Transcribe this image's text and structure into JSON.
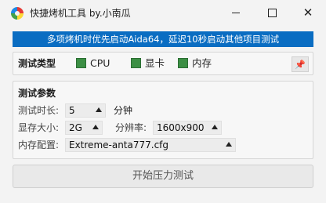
{
  "window": {
    "title": "快捷烤机工具 by.小南瓜",
    "min_icon": "minimize-icon",
    "max_icon": "maximize-icon",
    "close_icon": "close-icon"
  },
  "banner": {
    "text": "多项烤机时优先启动Aida64，延迟10秒启动其他项目测试",
    "color": "#0a6dc2"
  },
  "test_type": {
    "label": "测试类型",
    "options": [
      {
        "label": "CPU",
        "checked": true
      },
      {
        "label": "显卡",
        "checked": true
      },
      {
        "label": "内存",
        "checked": true
      }
    ],
    "pin_icon": "pin-icon",
    "check_color": "#3c8f44"
  },
  "params": {
    "title": "测试参数",
    "duration_label": "测试时长:",
    "duration_value": "5",
    "duration_unit": "分钟",
    "vram_label": "显存大小:",
    "vram_value": "2G",
    "resolution_label": "分辨率:",
    "resolution_value": "1600x900",
    "memcfg_label": "内存配置:",
    "memcfg_value": "Extreme-anta777.cfg"
  },
  "start_button": {
    "label": "开始压力测试"
  }
}
